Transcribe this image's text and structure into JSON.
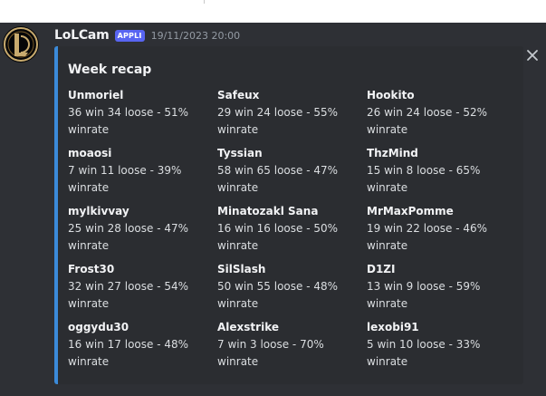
{
  "message": {
    "author": "LoLCam",
    "app_badge": "APPLI",
    "timestamp": "19/11/2023 20:00",
    "avatar_icon": "league-of-legends-logo-icon",
    "close_icon": "close-icon"
  },
  "embed": {
    "accent_color": "#3b8ad9",
    "title": "Week recap",
    "fields": [
      {
        "name": "Unmoriel",
        "value": "36 win 34 loose - 51% winrate"
      },
      {
        "name": "Safeux",
        "value": "29 win 24 loose - 55% winrate"
      },
      {
        "name": "Hookito",
        "value": "26 win 24 loose - 52% winrate"
      },
      {
        "name": "moaosi",
        "value": "7 win 11 loose - 39% winrate"
      },
      {
        "name": "Tyssian",
        "value": "58 win 65 loose - 47% winrate"
      },
      {
        "name": "ThzMind",
        "value": "15 win 8 loose - 65% winrate"
      },
      {
        "name": "mylkivvay",
        "value": "25 win 28 loose - 47% winrate"
      },
      {
        "name": "Minatozakl Sana",
        "value": "16 win 16 loose - 50% winrate"
      },
      {
        "name": "MrMaxPomme",
        "value": "19 win 22 loose - 46% winrate"
      },
      {
        "name": "Frost30",
        "value": "32 win 27 loose - 54% winrate"
      },
      {
        "name": "SilSlash",
        "value": "50 win 55 loose - 48% winrate"
      },
      {
        "name": "D1ZI",
        "value": "13 win 9 loose - 59% winrate"
      },
      {
        "name": "oggydu30",
        "value": "16 win 17 loose - 48% winrate"
      },
      {
        "name": "Alexstrike",
        "value": "7 win 3 loose - 70% winrate"
      },
      {
        "name": "lexobi91",
        "value": "5 win 10 loose - 33% winrate"
      }
    ]
  }
}
